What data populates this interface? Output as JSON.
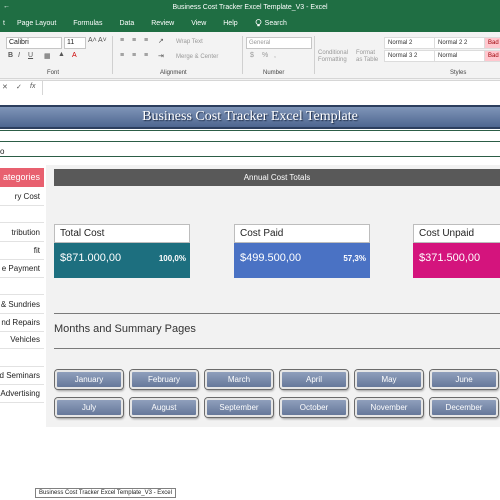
{
  "window": {
    "title": "Business Cost Tracker Excel Template_V3  -  Excel",
    "tooltip": "Business Cost Tracker Excel Template_V3 - Excel"
  },
  "ribbon": {
    "tabs": [
      "t",
      "Page Layout",
      "Formulas",
      "Data",
      "Review",
      "View",
      "Help"
    ],
    "search_label": "Search",
    "font_name": "Calibri",
    "font_size": "11",
    "wrap_text": "Wrap Text",
    "merge_center": "Merge & Center",
    "number_format": "General",
    "conditional_formatting": "Conditional Formatting",
    "format_as_table": "Format as Table",
    "groups": {
      "font": "Font",
      "alignment": "Alignment",
      "number": "Number",
      "styles": "Styles"
    },
    "styles": [
      "Normal 2",
      "Normal 2 2",
      "Bad",
      "Normal 3 2",
      "Normal",
      "Bad"
    ]
  },
  "formula_bar": {
    "fx": "fx"
  },
  "sheet": {
    "banner": "Business Cost Tracker Excel Template",
    "row_a_text": "o",
    "sidebar_header": "ategories",
    "sidebar_items": [
      "ry Cost",
      "",
      "tribution",
      "fit",
      "e Payment",
      "",
      "& Sundries",
      "nd Repairs",
      "Vehicles",
      "",
      "nd Seminars",
      "Advertising"
    ],
    "annual_header": "Annual Cost Totals",
    "cards": [
      {
        "title": "Total Cost",
        "amount": "$871.000,00",
        "pct": "100,0%",
        "color": "#1d6f7f"
      },
      {
        "title": "Cost Paid",
        "amount": "$499.500,00",
        "pct": "57,3%",
        "color": "#4a72c4"
      },
      {
        "title": "Cost Unpaid",
        "amount": "$371.500,00",
        "pct": "",
        "color": "#d4147d"
      }
    ],
    "months_title": "Months and Summary Pages",
    "months": [
      "January",
      "February",
      "March",
      "April",
      "May",
      "June",
      "July",
      "August",
      "September",
      "October",
      "November",
      "December"
    ]
  }
}
